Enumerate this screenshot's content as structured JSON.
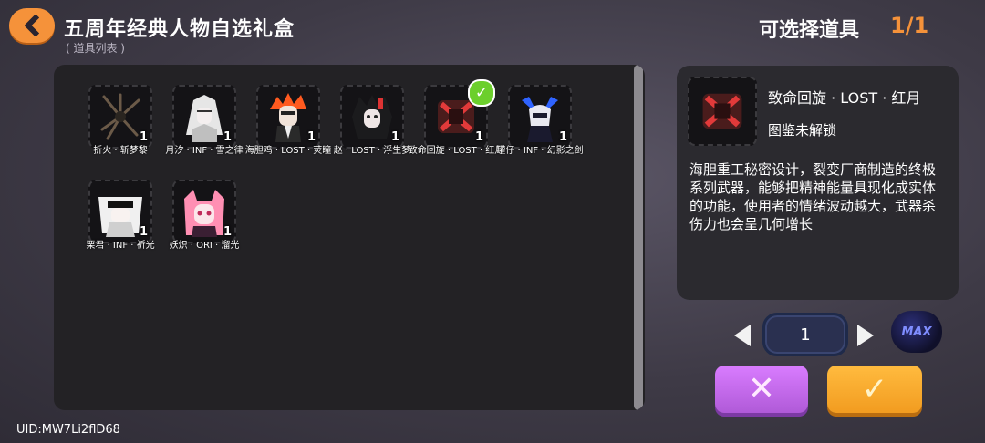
{
  "header": {
    "title": "五周年经典人物自选礼盒",
    "subtitle": "( 道具列表 )",
    "select_label": "可选择道具",
    "select_count": "1/1"
  },
  "items": [
    {
      "name": "折火 · 斩梦黎",
      "qty": "1",
      "icon": "dark-spiky-character-icon",
      "selected": false
    },
    {
      "name": "月汐 · INF · 雪之律",
      "qty": "1",
      "icon": "white-hair-character-icon",
      "selected": false
    },
    {
      "name": "海胆鸡 · LOST · 荧瞳",
      "qty": "1",
      "icon": "orange-hair-character-icon",
      "selected": false
    },
    {
      "name": "赵 · LOST · 浮生梦",
      "qty": "1",
      "icon": "black-hair-character-icon",
      "selected": false
    },
    {
      "name": "致命回旋 · LOST · 红月",
      "qty": "1",
      "icon": "red-weapon-icon",
      "selected": true
    },
    {
      "name": "罐仔 · INF · 幻影之剑",
      "qty": "1",
      "icon": "blue-helmet-character-icon",
      "selected": false
    },
    {
      "name": "栗君 · INF · 祈光",
      "qty": "1",
      "icon": "white-hair-glasses-character-icon",
      "selected": false
    },
    {
      "name": "妖炽 · ORI · 溜光",
      "qty": "1",
      "icon": "pink-hair-character-icon",
      "selected": false
    }
  ],
  "detail": {
    "name": "致命回旋 · LOST · 红月",
    "status": "图鉴未解锁",
    "description": "海胆重工秘密设计，裂变厂商制造的终极系列武器，能够把精神能量具现化成实体的功能，使用者的情绪波动越大，武器杀伤力也会呈几何增长"
  },
  "quantity": {
    "value": "1",
    "max_label": "MAX"
  },
  "footer": {
    "uid": "UID:MW7Li2flD68"
  },
  "colors": {
    "accent": "#f5923a",
    "cancel": "#c36ae8",
    "confirm": "#f6a52a",
    "check": "#6ccf2c"
  }
}
